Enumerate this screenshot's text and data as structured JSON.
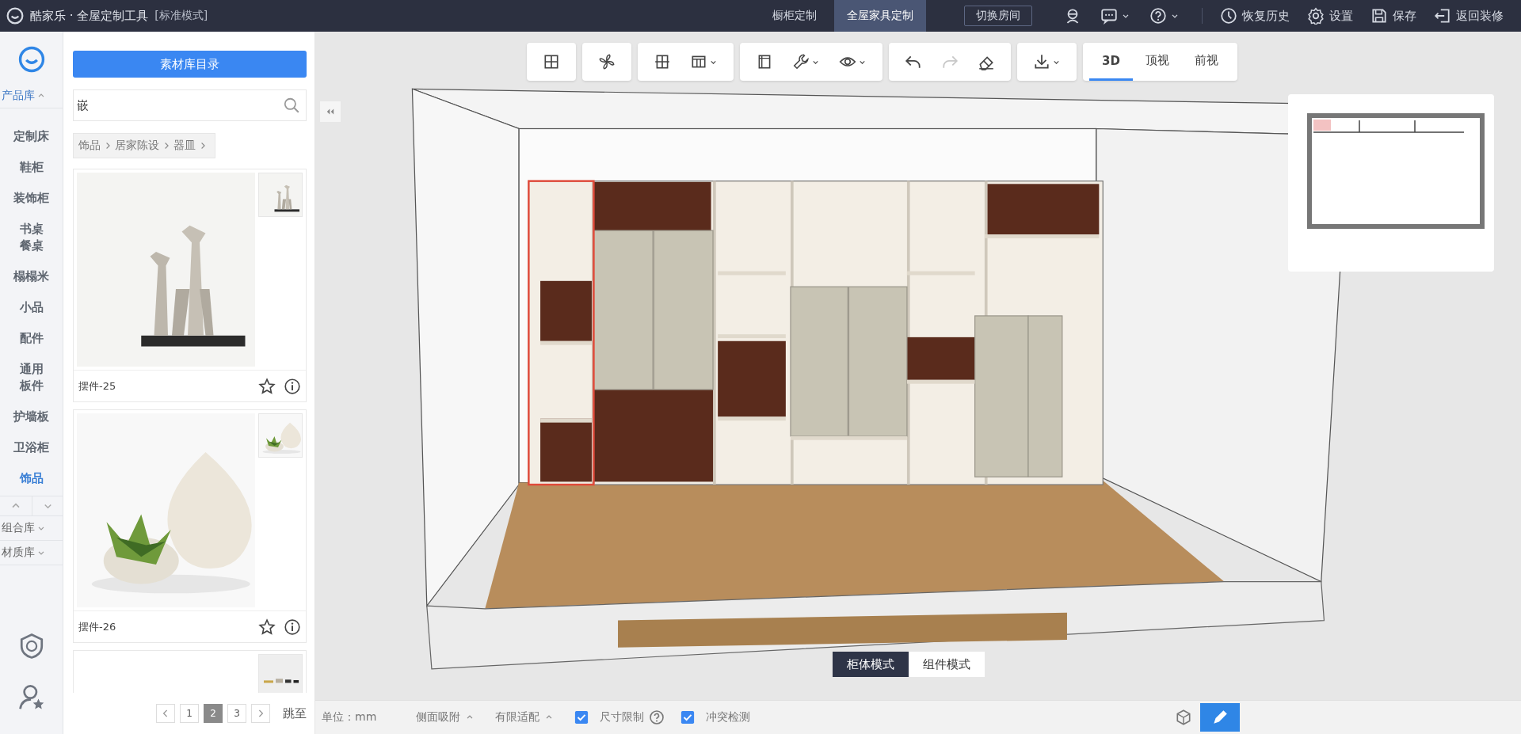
{
  "app_title": "酷家乐 · 全屋定制工具",
  "mode_label": "[标准模式]",
  "top_tabs": [
    {
      "label": "橱柜定制",
      "selected": false
    },
    {
      "label": "全屋家具定制",
      "selected": true
    }
  ],
  "switch_room_button": "切换房间",
  "top_actions": [
    {
      "kind": "history",
      "label": "恢复历史"
    },
    {
      "kind": "settings",
      "label": "设置"
    },
    {
      "kind": "save",
      "label": "保存"
    },
    {
      "kind": "exit",
      "label": "返回装修"
    }
  ],
  "rail": {
    "product_library": {
      "label": "产品库",
      "expanded": true,
      "items": [
        {
          "label": "定制床",
          "selected": false
        },
        {
          "label": "鞋柜",
          "selected": false
        },
        {
          "label": "装饰柜",
          "selected": false
        },
        {
          "label": "书桌餐桌",
          "selected": false
        },
        {
          "label": "榻榻米",
          "selected": false
        },
        {
          "label": "小品",
          "selected": false
        },
        {
          "label": "配件",
          "selected": false
        },
        {
          "label": "通用板件",
          "selected": false
        },
        {
          "label": "护墙板",
          "selected": false
        },
        {
          "label": "卫浴柜",
          "selected": false
        },
        {
          "label": "饰品",
          "selected": true
        }
      ]
    },
    "libraries": [
      {
        "label": "组合库",
        "expanded": false
      },
      {
        "label": "材质库",
        "expanded": false
      }
    ]
  },
  "catalog_button": "素材库目录",
  "search": {
    "value": "嵌"
  },
  "breadcrumb": [
    "饰品",
    "居家陈设",
    "器皿"
  ],
  "products": [
    {
      "kind": "picture",
      "name": "摆件-25",
      "favorite": false
    },
    {
      "kind": "picture",
      "name": "摆件-26",
      "favorite": false
    },
    {
      "kind": "picture"
    }
  ],
  "pagination": {
    "pages": [
      {
        "label": "1",
        "selected": false
      },
      {
        "label": "2",
        "selected": true
      },
      {
        "label": "3",
        "selected": false
      }
    ],
    "jump_label": "跳至"
  },
  "toolbar": {
    "redo": {
      "disabled": true
    },
    "views": [
      {
        "label": "3D",
        "selected": true
      },
      {
        "label": "顶视",
        "selected": false
      },
      {
        "label": "前视",
        "selected": false
      }
    ]
  },
  "mode_toggle": [
    {
      "label": "柜体模式",
      "selected": true
    },
    {
      "label": "组件模式",
      "selected": false
    }
  ],
  "status_bar": {
    "unit_label": "单位：mm",
    "options": [
      {
        "kind": "dropdown",
        "label": "侧面吸附"
      },
      {
        "kind": "dropdown",
        "label": "有限适配"
      },
      {
        "kind": "checkbox",
        "label": "尺寸限制",
        "checked": true,
        "help": true
      },
      {
        "kind": "checkbox",
        "label": "冲突检测",
        "checked": true
      }
    ],
    "pen_tool": {
      "selected": true
    }
  }
}
